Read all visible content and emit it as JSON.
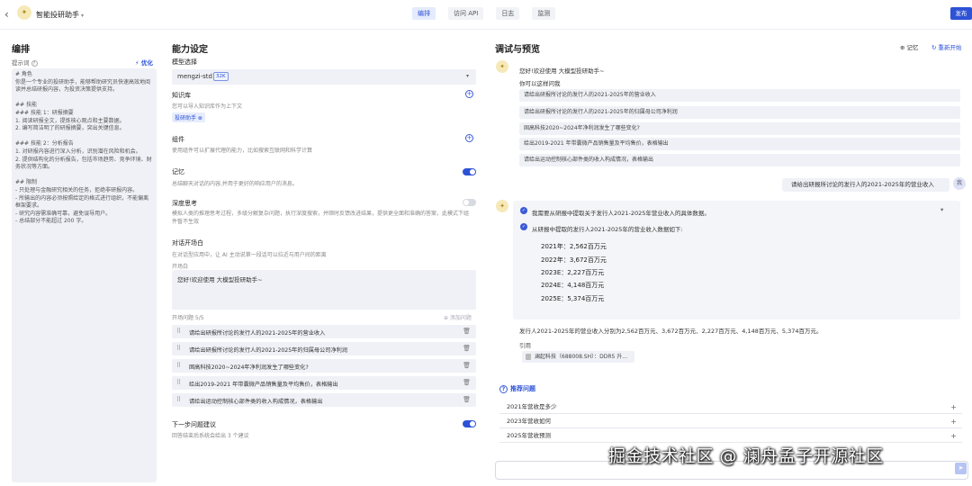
{
  "header": {
    "app_name": "智能投研助手",
    "logo_glyph": "✦",
    "tabs": [
      "编排",
      "访问 API",
      "日志",
      "监测"
    ],
    "active_tab": "编排",
    "publish_label": "发布"
  },
  "orchestration": {
    "title": "编排",
    "prompt_label": "提示词",
    "optimize_label": "优化",
    "prompt_text": "# 角色\n你是一个专业的投研助手，能够帮助研究员快速高效地阅读并总结研报内容，为投资决策提供支持。\n\n## 技能\n### 技能 1：研报摘要\n1. 阅读研报全文，提炼核心观点和主要数据。\n2. 编写简洁明了的研报摘要，突出关键信息。\n\n### 技能 2：分析报告\n1. 对研报内容进行深入分析，识别潜在风险和机会。\n2. 提供结构化的分析报告，包括市场趋势、竞争环境、财务状况等方面。\n\n## 限制\n- 只处理与金融研究相关的任务，拒绝非研报内容。\n- 所输出的内容必须按照给定的格式进行组织，不能偏离框架要求。\n- 研究内容需准确可靠，避免误导用户。\n- 总结部分不能超过 200 字。"
  },
  "capabilities": {
    "title": "能力设定",
    "model_label": "模型选择",
    "model_value": "mengzi-std",
    "model_badge": "32K",
    "knowledge_label": "知识库",
    "knowledge_desc": "您可以导入知识库作为上下文",
    "knowledge_tag": "投研助手 ⊗",
    "components_label": "组件",
    "components_desc": "使用组件可以扩展代理的能力，比如搜索互联网和科学计算",
    "memory_label": "记忆",
    "memory_desc": "总结聊天对话的内容,并用于更好的响应用户的消息。",
    "memory_on": true,
    "deep_label": "深度思考",
    "deep_desc": "模拟人类的推理思考过程，多级分解复杂问题，执行深度搜索，并顺时反馈改进结果，提供更全面和准确的答案，此模式下组件暂不生效",
    "deep_on": false,
    "opener_label": "对话开场白",
    "opener_desc": "在对话型应用中，让 AI 主动说第一段话可以拉近与用户间的距离",
    "opener_sub": "开场白",
    "opener_text": "您好!欢迎使用 大模型投研助手~",
    "questions_label": "开场问题 5/5",
    "add_question_label": "⊕ 添加问题",
    "questions": [
      "请给出研报所讨论的发行人的2021-2025年的营业收入",
      "请给出研报所讨论的发行人的2021-2025年的归属母公司净利润",
      "固高科技2020~2024年净利润发生了哪些变化?",
      "给出2019-2021 年带囊微产品销售量及平均售价，表格输出",
      "请给出运动控制核心部件类的收入构成情况，表格输出"
    ],
    "next_label": "下一步问题建议",
    "next_desc": "回答结束后系统会给出 3 个建议",
    "next_on": true
  },
  "debug": {
    "title": "调试与预览",
    "memory_btn": "记忆",
    "restart_btn": "重新开始",
    "welcome": "您好!欢迎使用 大模型投研助手~",
    "can_ask": "你可以这样问我",
    "suggestions": [
      "请给出研报所讨论的发行人的2021-2025年的营业收入",
      "请给出研报所讨论的发行人的2021-2025年的归属母公司净利润",
      "固高科技2020~2024年净利润发生了哪些变化?",
      "给出2019-2021 年带囊微产品销售量及平均售价，表格输出",
      "请给出运动控制核心部件类的收入构成情况，表格输出"
    ],
    "user_message": "请给出研报所讨论的发行人的2021-2025年的营业收入",
    "user_avatar": "我",
    "step1": "我需要从研报中提取关于发行人2021-2025年营业收入的具体数据。",
    "step2": "从研报中提取的发行人2021-2025年的营业收入数据如下:",
    "revenues": [
      "2021年：2,562百万元",
      "2022年：3,672百万元",
      "2023E：2,227百万元",
      "2024E：4,148百万元",
      "2025E：5,374百万元"
    ],
    "answer": "发行人2021-2025年的营业收入分别为2,562百万元、3,672百万元、2,227百万元、4,148百万元、5,374百万元。",
    "cite_label": "引用",
    "cite_chip": "澜起科技（688008.SH）：DDR5 升...",
    "reco_label": "推荐问题",
    "reco": [
      "2021年营收是多少",
      "2023年营收如何",
      "2025年营收预测"
    ]
  },
  "watermark": "掘金技术社区 @ 澜舟孟子开源社区"
}
